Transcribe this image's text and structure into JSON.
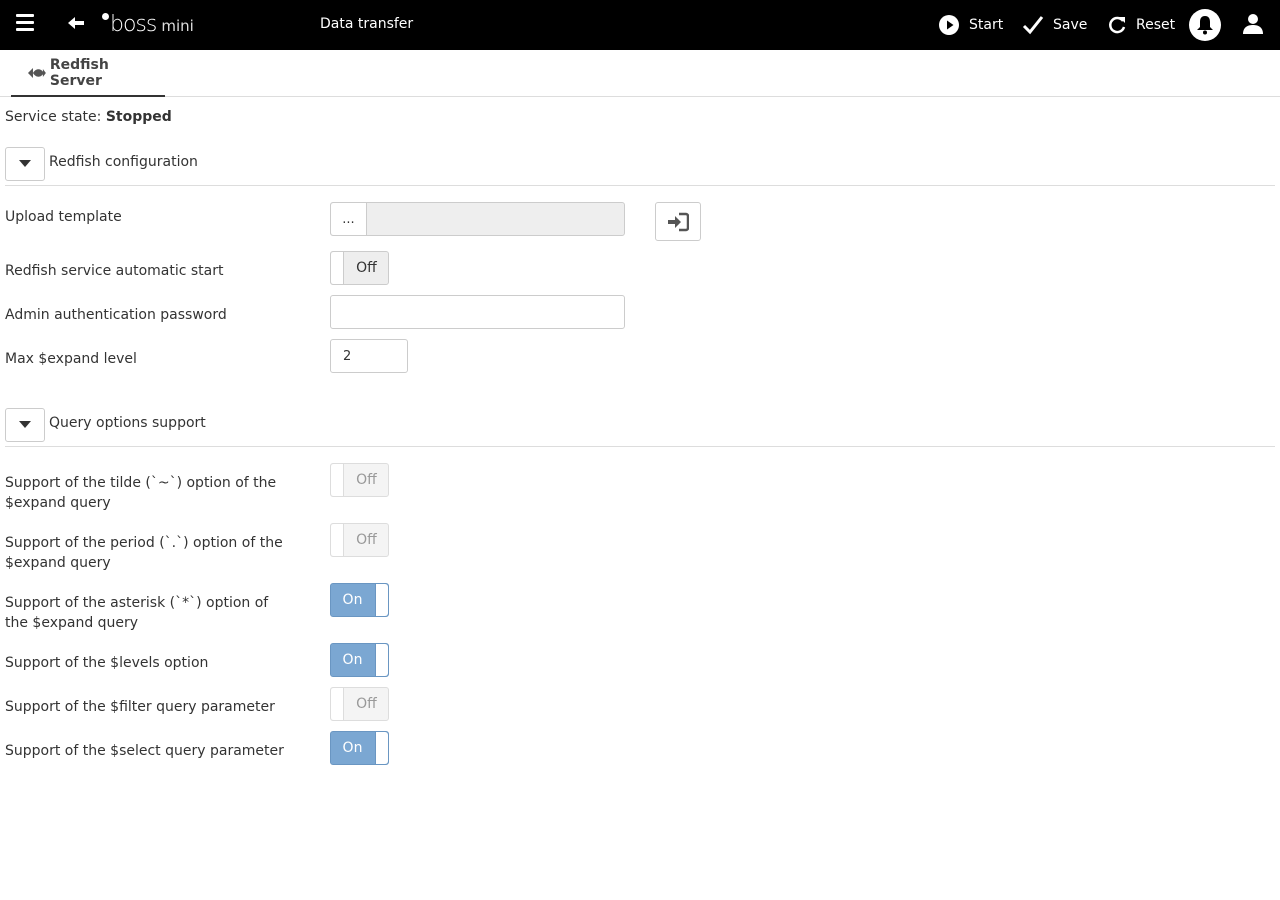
{
  "header": {
    "logo_text": "boss",
    "logo_suffix": "mini",
    "page_title": "Data transfer",
    "actions": {
      "start": "Start",
      "save": "Save",
      "reset": "Reset"
    }
  },
  "tab": {
    "label": "Redfish Server"
  },
  "service_state": {
    "label": "Service state:",
    "value": "Stopped"
  },
  "sections": {
    "redfish_config": {
      "title": "Redfish configuration"
    },
    "query_options": {
      "title": "Query options support"
    }
  },
  "config": {
    "upload_template": {
      "label": "Upload template",
      "button": "..."
    },
    "auto_start": {
      "label": "Redfish service automatic start",
      "state": "Off"
    },
    "admin_password": {
      "label": "Admin authentication password",
      "value": ""
    },
    "max_expand": {
      "label": "Max $expand level",
      "value": "2"
    }
  },
  "query_options": {
    "tilde": {
      "label": "Support of the tilde (`~`) option of the $expand query",
      "state": "Off"
    },
    "period": {
      "label": "Support of the period (`.`) option of the $expand query",
      "state": "Off"
    },
    "asterisk": {
      "label": "Support of the asterisk (`*`) option of the $expand query",
      "state": "On"
    },
    "levels": {
      "label": "Support of the $levels option",
      "state": "On"
    },
    "filter": {
      "label": "Support of the $filter query parameter",
      "state": "Off"
    },
    "select": {
      "label": "Support of the $select query parameter",
      "state": "On"
    }
  },
  "colors": {
    "topbar": "#000000",
    "toggle_on": "#7ba7d2",
    "accent": "#333333"
  }
}
